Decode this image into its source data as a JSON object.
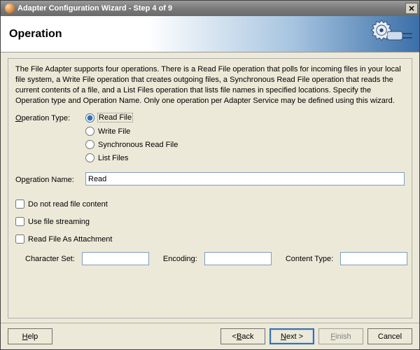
{
  "window": {
    "title": "Adapter Configuration Wizard - Step 4 of 9"
  },
  "header": {
    "title": "Operation"
  },
  "intro": "The File Adapter supports four operations.  There is a Read File operation that polls for incoming files in your local file system, a Write File operation that creates outgoing files, a Synchronous Read File operation that reads the current contents of a file, and a List Files operation that lists file names in specified locations.  Specify the Operation type and Operation Name.  Only one operation per Adapter Service may be defined using this wizard.",
  "labels": {
    "operation_type_pre": "O",
    "operation_type_post": "peration Type:",
    "operation_name_pre": "Op",
    "operation_name_mid": "e",
    "operation_name_post": "ration Name:"
  },
  "operationType": {
    "options": {
      "read": {
        "ul": "R",
        "rest": "ead File"
      },
      "write": {
        "ul": "W",
        "rest": "rite File"
      },
      "sync": {
        "ul": "S",
        "rest": "ynchronous Read File"
      },
      "list": {
        "ul": "L",
        "rest": "ist Files"
      }
    }
  },
  "operationName": {
    "value": "Read"
  },
  "checks": {
    "noread": {
      "ul": "D",
      "rest": "o not read file content"
    },
    "stream": {
      "ul": "U",
      "rest": "se file streaming"
    },
    "attach": {
      "text": "Read File As Attachment"
    }
  },
  "subfields": {
    "charset_label": "Character Set:",
    "charset_value": "",
    "encoding_label": "Encoding:",
    "encoding_value": "",
    "contenttype_label": "Content Type:",
    "contenttype_value": ""
  },
  "buttons": {
    "help": {
      "ul": "H",
      "rest": "elp"
    },
    "back": {
      "pre": "< ",
      "ul": "B",
      "rest": "ack"
    },
    "next": {
      "ul": "N",
      "rest": "ext >"
    },
    "finish": {
      "ul": "F",
      "rest": "inish"
    },
    "cancel": {
      "text": "Cancel"
    }
  }
}
